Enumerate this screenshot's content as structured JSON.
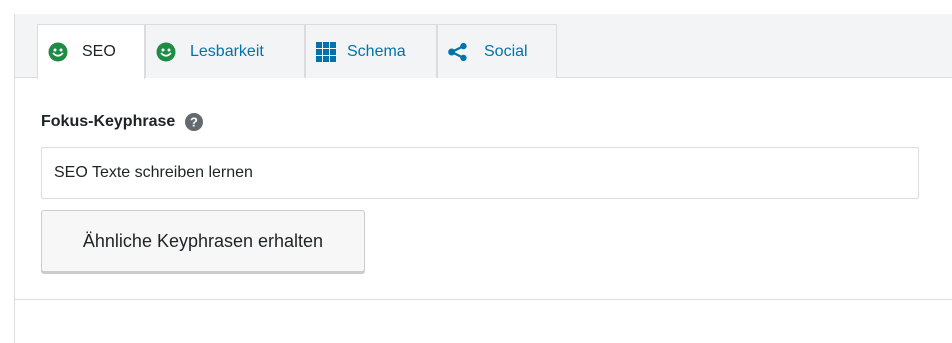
{
  "tabs": [
    {
      "label": "SEO",
      "icon": "smiley-green-icon",
      "active": true
    },
    {
      "label": "Lesbarkeit",
      "icon": "smiley-green-icon",
      "active": false
    },
    {
      "label": "Schema",
      "icon": "grid-icon",
      "active": false
    },
    {
      "label": "Social",
      "icon": "share-icon",
      "active": false
    }
  ],
  "focus": {
    "label": "Fokus-Keyphrase",
    "help_icon": "question-circle-icon",
    "value": "SEO Texte schreiben lernen",
    "related_button": "Ähnliche Keyphrasen erhalten"
  },
  "colors": {
    "tab_link": "#0073aa",
    "smiley_green": "#1e8c45",
    "text": "#1d2327",
    "border": "#dcdcde"
  }
}
